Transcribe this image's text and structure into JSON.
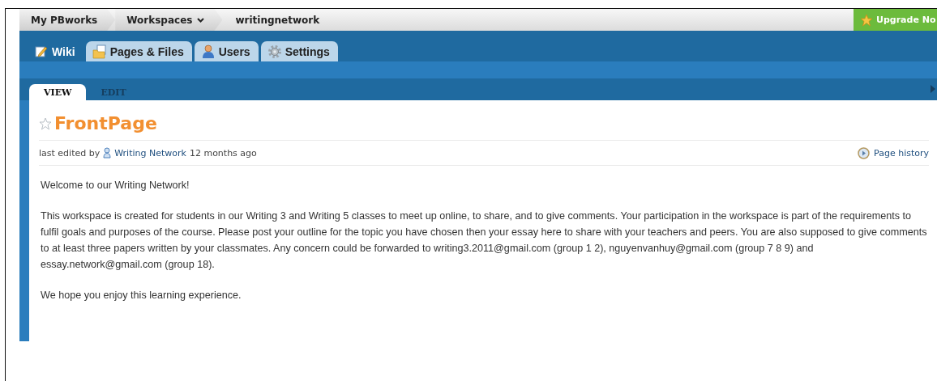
{
  "breadcrumbs": [
    {
      "label": "My PBworks",
      "kind": "link"
    },
    {
      "label": "Workspaces",
      "kind": "menu"
    },
    {
      "label": "writingnetwork",
      "kind": "current"
    }
  ],
  "upgrade": {
    "label": "Upgrade No"
  },
  "tabs": [
    {
      "label": "Wiki",
      "kind": "wiki",
      "selected": true
    },
    {
      "label": "Pages & Files",
      "kind": "pages",
      "selected": false
    },
    {
      "label": "Users",
      "kind": "users",
      "selected": false
    },
    {
      "label": "Settings",
      "kind": "settings",
      "selected": false
    }
  ],
  "view_tabs": [
    {
      "label": "VIEW",
      "selected": true
    },
    {
      "label": "EDIT",
      "selected": false
    }
  ],
  "page": {
    "title": "FrontPage",
    "meta": {
      "prefix": "last edited by",
      "author": "Writing Network",
      "time": "12 months ago"
    },
    "history": "Page history",
    "paragraphs": [
      "Welcome to our Writing Network!",
      "This workspace is created for students in our Writing 3 and Writing 5 classes to meet up online, to share, and to give comments. Your participation in the workspace is part of the requirements to fulfil goals and purposes of the course. Please post your outline for the topic you have chosen then your essay here to share with your teachers and peers. You are also supposed to give comments to at least three papers written by your classmates. Any concern could be forwarded to writing3.2011@gmail.com (group 1 2), nguyenvanhuy@gmail.com (group 7 8 9) and essay.network@gmail.com (group 18).",
      "We hope you enjoy this learning experience."
    ]
  }
}
